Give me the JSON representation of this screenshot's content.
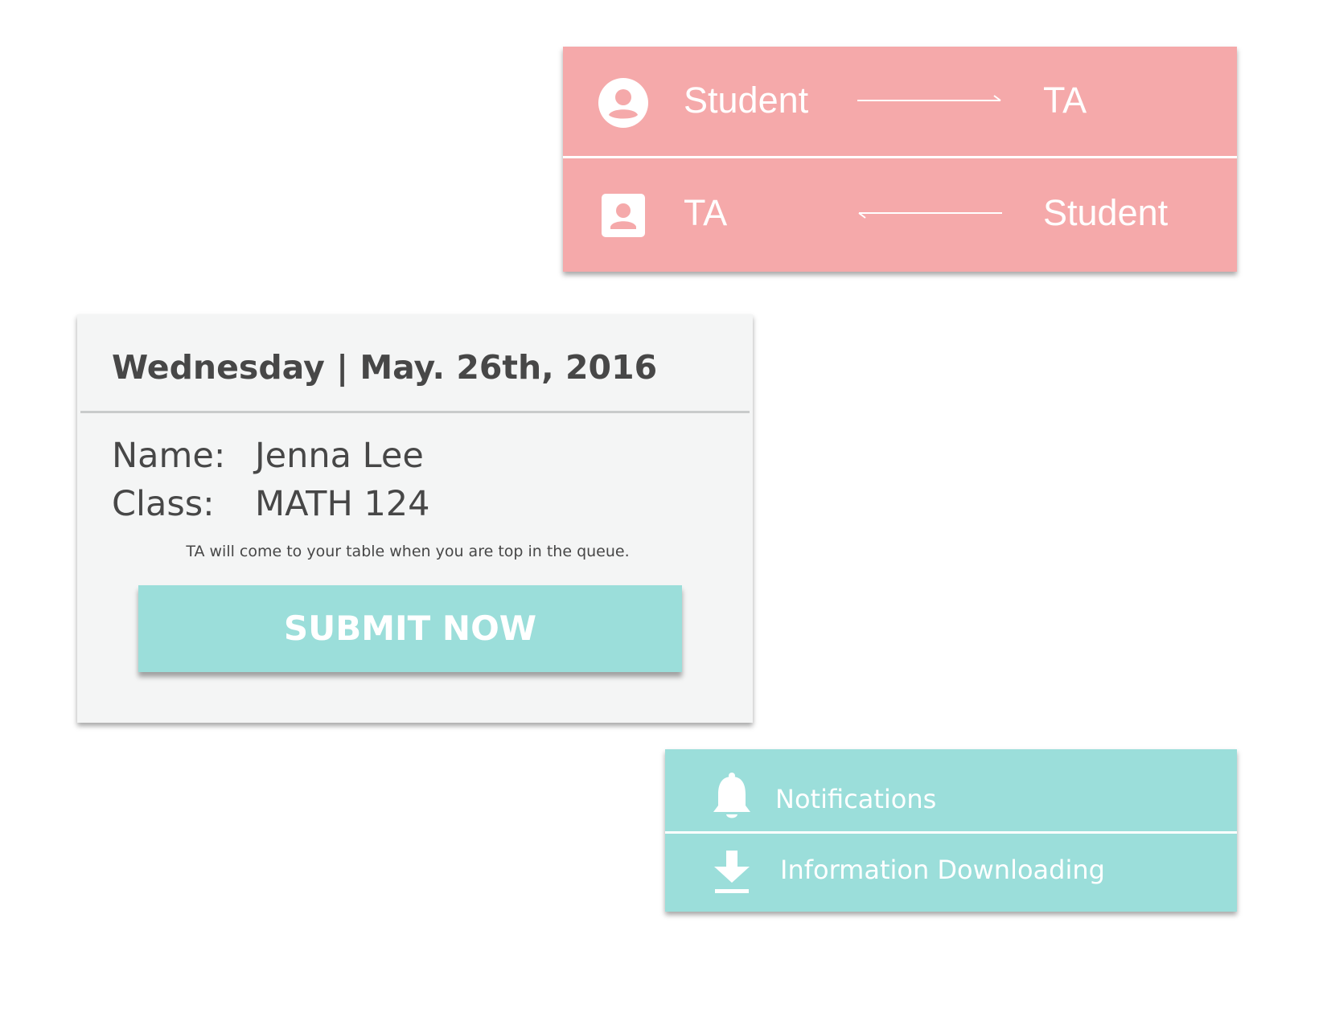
{
  "role_switch": {
    "rows": [
      {
        "from": "Student",
        "to": "TA",
        "icon": "account-circle-icon",
        "arrow": "right-arrow-icon"
      },
      {
        "from": "TA",
        "to": "Student",
        "icon": "account-box-icon",
        "arrow": "left-arrow-icon"
      }
    ]
  },
  "queue_form": {
    "date": "Wednesday | May. 26th, 2016",
    "name_label": "Name:",
    "name_value": "Jenna Lee",
    "class_label": "Class:",
    "class_value": "MATH 124",
    "note": "TA will come to your table when you are top in the queue.",
    "submit_label": "SUBMIT NOW"
  },
  "settings": {
    "items": [
      {
        "label": "Notifications",
        "icon": "bell-icon"
      },
      {
        "label": "Information Downloading",
        "icon": "download-icon"
      }
    ]
  },
  "colors": {
    "pink": "#f5a9aa",
    "teal": "#9bdeda",
    "card_grey": "#f4f5f5",
    "text_dark": "#474747",
    "white": "#ffffff"
  }
}
